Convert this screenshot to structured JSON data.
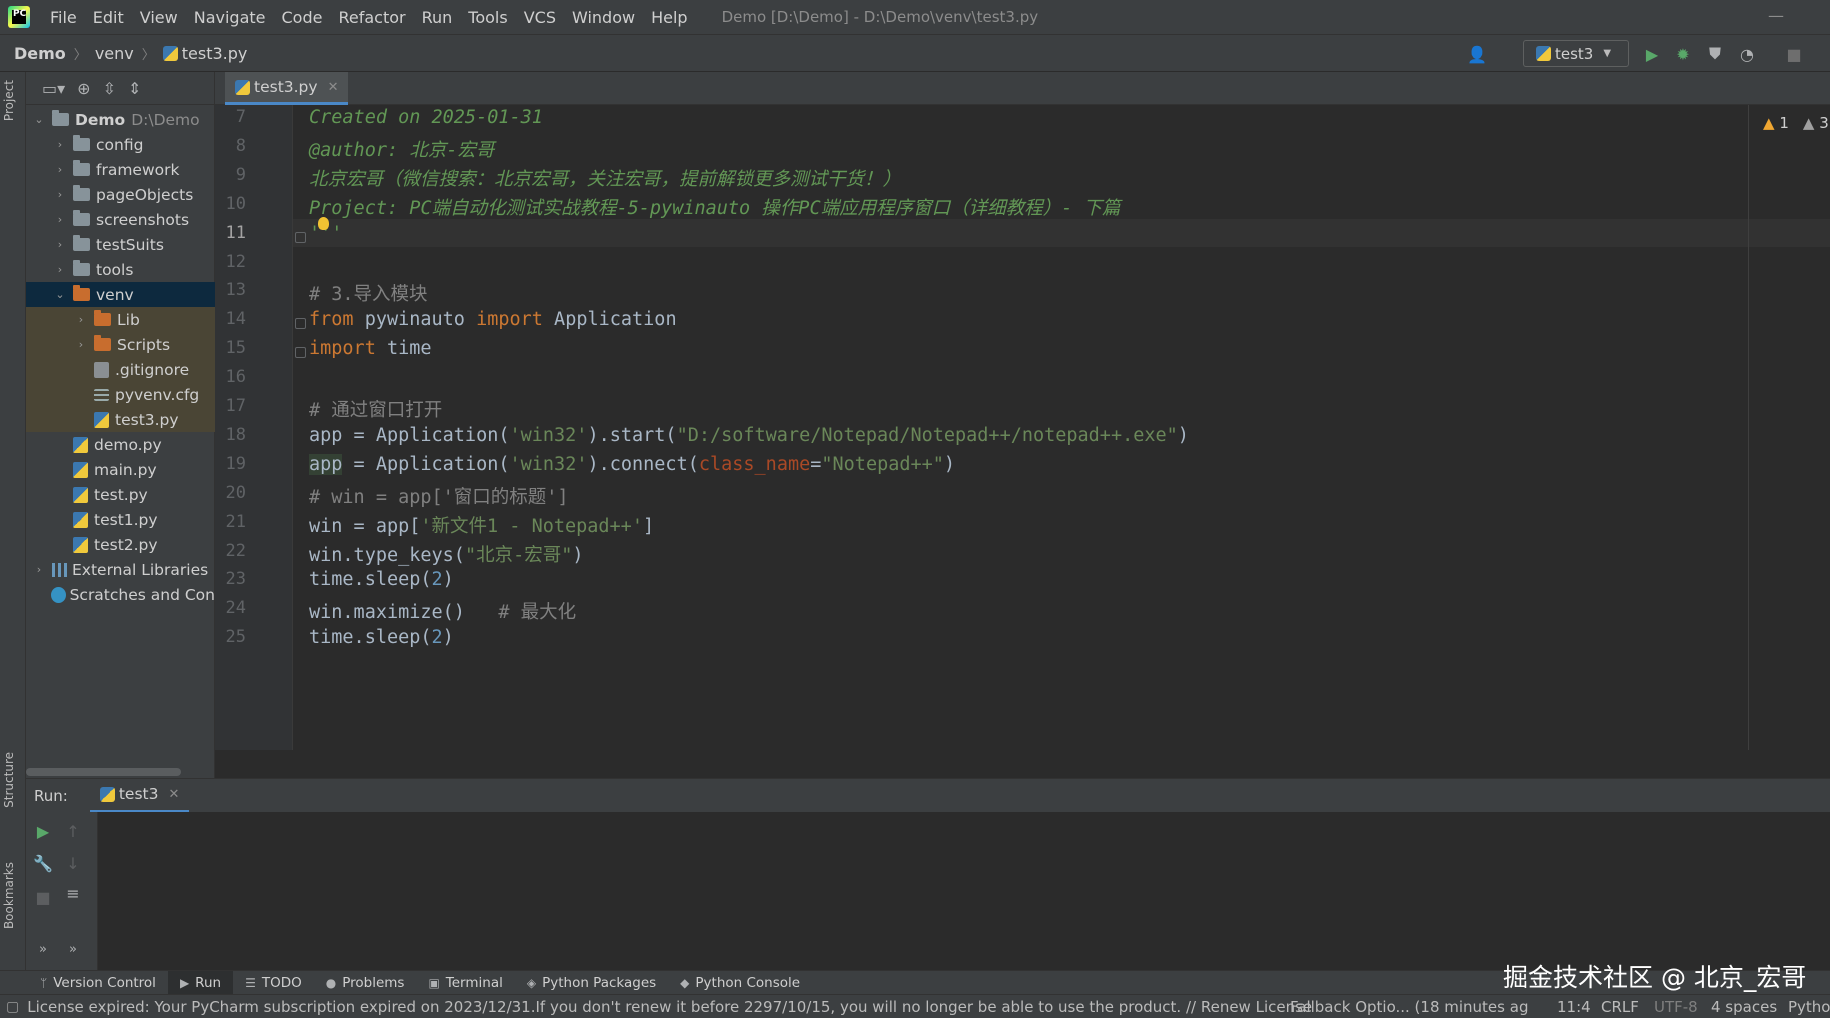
{
  "menubar": {
    "logo_text": "PC",
    "items": [
      "File",
      "Edit",
      "View",
      "Navigate",
      "Code",
      "Refactor",
      "Run",
      "Tools",
      "VCS",
      "Window",
      "Help"
    ],
    "window_title": "Demo [D:\\Demo] - D:\\Demo\\venv\\test3.py",
    "minimize_glyph": "—"
  },
  "navbar": {
    "crumbs": [
      "Demo",
      "venv",
      "test3.py"
    ],
    "run_config": "test3"
  },
  "left_stripe": {
    "project_tab": "Project",
    "structure_tab": "Structure",
    "bookmarks_tab": "Bookmarks"
  },
  "project_tree": [
    {
      "indent": 0,
      "chevron": "⌄",
      "icon": "folder",
      "label": "Demo",
      "hint": "D:\\Demo",
      "bold": true
    },
    {
      "indent": 1,
      "chevron": "›",
      "icon": "folder",
      "label": "config"
    },
    {
      "indent": 1,
      "chevron": "›",
      "icon": "folder",
      "label": "framework"
    },
    {
      "indent": 1,
      "chevron": "›",
      "icon": "folder",
      "label": "pageObjects"
    },
    {
      "indent": 1,
      "chevron": "›",
      "icon": "folder",
      "label": "screenshots"
    },
    {
      "indent": 1,
      "chevron": "›",
      "icon": "folder",
      "label": "testSuits"
    },
    {
      "indent": 1,
      "chevron": "›",
      "icon": "folder",
      "label": "tools"
    },
    {
      "indent": 1,
      "chevron": "⌄",
      "icon": "folder-orange",
      "label": "venv",
      "selected": true
    },
    {
      "indent": 2,
      "chevron": "›",
      "icon": "folder-orange",
      "label": "Lib",
      "venv": true
    },
    {
      "indent": 2,
      "chevron": "›",
      "icon": "folder-orange",
      "label": "Scripts",
      "venv": true
    },
    {
      "indent": 2,
      "chevron": "",
      "icon": "git",
      "label": ".gitignore",
      "venv": true
    },
    {
      "indent": 2,
      "chevron": "",
      "icon": "cfg",
      "label": "pyvenv.cfg",
      "venv": true
    },
    {
      "indent": 2,
      "chevron": "",
      "icon": "py",
      "label": "test3.py",
      "venv": true
    },
    {
      "indent": 1,
      "chevron": "",
      "icon": "py",
      "label": "demo.py"
    },
    {
      "indent": 1,
      "chevron": "",
      "icon": "py",
      "label": "main.py"
    },
    {
      "indent": 1,
      "chevron": "",
      "icon": "py",
      "label": "test.py"
    },
    {
      "indent": 1,
      "chevron": "",
      "icon": "py",
      "label": "test1.py"
    },
    {
      "indent": 1,
      "chevron": "",
      "icon": "py",
      "label": "test2.py"
    },
    {
      "indent": 0,
      "chevron": "›",
      "icon": "lib",
      "label": "External Libraries"
    },
    {
      "indent": 0,
      "chevron": "",
      "icon": "scratch",
      "label": "Scratches and Con"
    }
  ],
  "editor": {
    "tab_label": "test3.py",
    "current_line": 11,
    "warnings": [
      {
        "count": "1",
        "kind": "warning"
      },
      {
        "count": "3",
        "kind": "weak"
      }
    ],
    "lines": [
      {
        "n": 7,
        "tokens": [
          [
            "cmt-doc",
            "Created on 2025-01-31"
          ]
        ]
      },
      {
        "n": 8,
        "tokens": [
          [
            "cmt-doc",
            "@author: 北京-宏哥"
          ]
        ]
      },
      {
        "n": 9,
        "tokens": [
          [
            "cmt-doc",
            "北京宏哥（微信搜索：北京宏哥，关注宏哥，提前解锁更多测试干货！）"
          ]
        ]
      },
      {
        "n": 10,
        "tokens": [
          [
            "cmt-doc",
            "Project: PC端自动化测试实战教程-5-pywinauto 操作PC端应用程序窗口（详细教程）- 下篇"
          ]
        ]
      },
      {
        "n": 11,
        "tokens": [
          [
            "cmt-doc",
            "'''"
          ]
        ]
      },
      {
        "n": 12,
        "tokens": []
      },
      {
        "n": 13,
        "tokens": [
          [
            "cmt",
            "# 3.导入模块"
          ]
        ]
      },
      {
        "n": 14,
        "tokens": [
          [
            "kw",
            "from"
          ],
          [
            "",
            " pywinauto "
          ],
          [
            "kw",
            "import"
          ],
          [
            "",
            " Application"
          ]
        ]
      },
      {
        "n": 15,
        "tokens": [
          [
            "kw",
            "import"
          ],
          [
            "",
            " time"
          ]
        ]
      },
      {
        "n": 16,
        "tokens": []
      },
      {
        "n": 17,
        "tokens": [
          [
            "cmt",
            "# 通过窗口打开"
          ]
        ]
      },
      {
        "n": 18,
        "tokens": [
          [
            "",
            "app = Application("
          ],
          [
            "str",
            "'win32'"
          ],
          [
            "",
            ").start("
          ],
          [
            "str",
            "\"D:/software/Notepad/Notepad++/notepad++.exe\""
          ],
          [
            "",
            ")"
          ]
        ]
      },
      {
        "n": 19,
        "tokens": [
          [
            "hl-usage",
            "app"
          ],
          [
            "",
            " = Application("
          ],
          [
            "str",
            "'win32'"
          ],
          [
            "",
            ").connect("
          ],
          [
            "param",
            "class_name"
          ],
          [
            "",
            "="
          ],
          [
            "str",
            "\"Notepad++\""
          ],
          [
            "",
            ")"
          ]
        ]
      },
      {
        "n": 20,
        "tokens": [
          [
            "cmt",
            "# win = app['窗口的标题']"
          ]
        ]
      },
      {
        "n": 21,
        "tokens": [
          [
            "",
            "win = app["
          ],
          [
            "str",
            "'新文件1 - Notepad++'"
          ],
          [
            "",
            "]"
          ]
        ]
      },
      {
        "n": 22,
        "tokens": [
          [
            "",
            "win.type_keys("
          ],
          [
            "str",
            "\"北京-宏哥\""
          ],
          [
            "",
            ")"
          ]
        ]
      },
      {
        "n": 23,
        "tokens": [
          [
            "",
            "time.sleep("
          ],
          [
            "num",
            "2"
          ],
          [
            "",
            ")"
          ]
        ]
      },
      {
        "n": 24,
        "tokens": [
          [
            "",
            "win.maximize()   "
          ],
          [
            "cmt",
            "# 最大化"
          ]
        ]
      },
      {
        "n": 25,
        "tokens": [
          [
            "",
            "time.sleep("
          ],
          [
            "num",
            "2"
          ],
          [
            "",
            ")"
          ]
        ]
      }
    ]
  },
  "run_panel": {
    "label": "Run:",
    "tab": "test3"
  },
  "bottom_tabs": [
    {
      "icon": "ᛘ",
      "label": "Version Control"
    },
    {
      "icon": "▶",
      "label": "Run",
      "active": true
    },
    {
      "icon": "☰",
      "label": "TODO"
    },
    {
      "icon": "●",
      "label": "Problems"
    },
    {
      "icon": "▣",
      "label": "Terminal"
    },
    {
      "icon": "◈",
      "label": "Python Packages"
    },
    {
      "icon": "◆",
      "label": "Python Console"
    }
  ],
  "statusbar": {
    "message": "License expired: Your PyCharm subscription expired on 2023/12/31.If you don't renew it before 2297/10/15, you will no longer be able to use the product. // Renew License",
    "fallback": "Fallback Optio... (18 minutes ag",
    "position": "11:4",
    "line_sep": "CRLF",
    "encoding": "UTF-8",
    "indent": "4 spaces",
    "interpreter": "Pytho"
  },
  "watermark": "掘金技术社区 @ 北京_宏哥",
  "colors": {
    "accent": "#4a88c7",
    "bg": "#2b2b2b",
    "panel": "#3c3f41",
    "selection": "#0d293e"
  }
}
